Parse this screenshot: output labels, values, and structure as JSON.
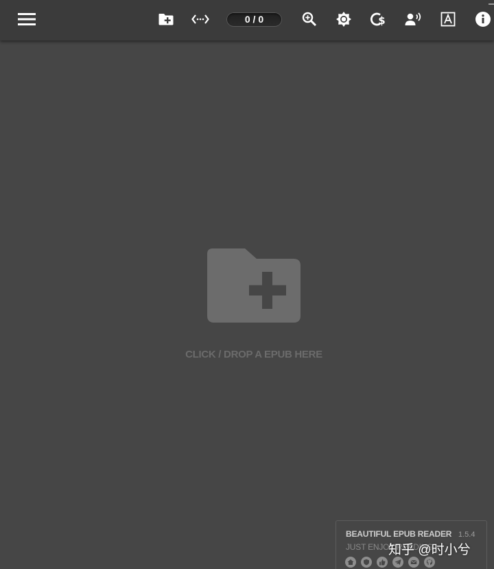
{
  "toolbar": {
    "page_counter": "0 / 0",
    "icons": [
      "menu-icon",
      "open-folder-icon",
      "page-width-icon",
      "zoom-icon",
      "brightness-icon",
      "dollar-icon",
      "text-to-speech-icon",
      "font-icon",
      "info-icon"
    ]
  },
  "drop_zone": {
    "label": "CLICK / DROP A EPUB HERE"
  },
  "info_box": {
    "app_name": "BEAUTIFUL EPUB READER",
    "version": "1.5.4",
    "tagline": "JUST ENJOY READING",
    "link_icons": [
      "home-icon",
      "shield-icon",
      "thumbs-up-icon",
      "telegram-icon",
      "email-icon",
      "github-icon"
    ]
  },
  "watermark": {
    "text": "知乎 @时小兮"
  },
  "colors": {
    "background": "#464646",
    "toolbar": "#3b3b3b",
    "icon": "#ffffff",
    "muted": "#6b6b6b"
  }
}
